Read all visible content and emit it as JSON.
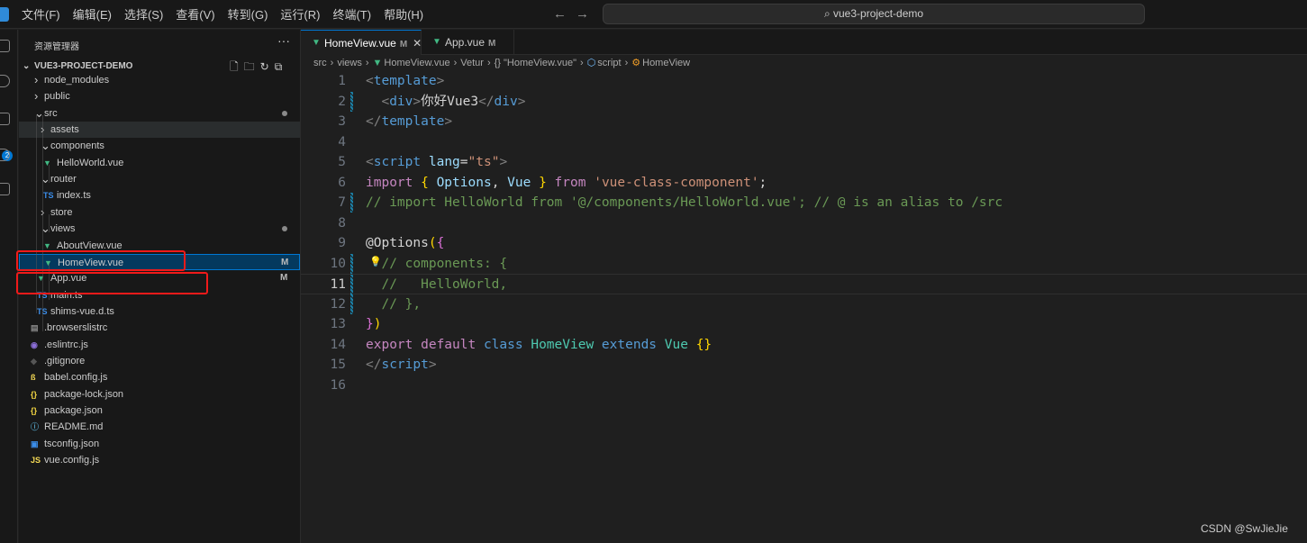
{
  "menu": [
    "文件(F)",
    "编辑(E)",
    "选择(S)",
    "查看(V)",
    "转到(G)",
    "运行(R)",
    "终端(T)",
    "帮助(H)"
  ],
  "search": {
    "label": "vue3-project-demo",
    "icon": "search-icon"
  },
  "activity": {
    "badge": "2"
  },
  "explorer": {
    "title": "资源管理器",
    "more": "···",
    "project": "VUE3-PROJECT-DEMO",
    "tree": [
      {
        "label": "node_modules",
        "kind": "folder",
        "depth": 1,
        "open": false
      },
      {
        "label": "public",
        "kind": "folder",
        "depth": 1,
        "open": false
      },
      {
        "label": "src",
        "kind": "folder",
        "depth": 1,
        "open": true,
        "dot": true
      },
      {
        "label": "assets",
        "kind": "folder",
        "depth": 2,
        "open": false,
        "hover": true
      },
      {
        "label": "components",
        "kind": "folder",
        "depth": 2,
        "open": true
      },
      {
        "label": "HelloWorld.vue",
        "kind": "vue",
        "depth": 3
      },
      {
        "label": "router",
        "kind": "folder",
        "depth": 2,
        "open": true
      },
      {
        "label": "index.ts",
        "kind": "ts",
        "depth": 3
      },
      {
        "label": "store",
        "kind": "folder",
        "depth": 2,
        "open": false
      },
      {
        "label": "views",
        "kind": "folder",
        "depth": 2,
        "open": true,
        "dot": true
      },
      {
        "label": "AboutView.vue",
        "kind": "vue",
        "depth": 3
      },
      {
        "label": "HomeView.vue",
        "kind": "vue",
        "depth": 3,
        "selected": true,
        "status": "M"
      },
      {
        "label": "App.vue",
        "kind": "vue",
        "depth": 2,
        "status": "M"
      },
      {
        "label": "main.ts",
        "kind": "ts",
        "depth": 2
      },
      {
        "label": "shims-vue.d.ts",
        "kind": "ts",
        "depth": 2
      },
      {
        "label": ".browserslistrc",
        "kind": "file",
        "depth": 1
      },
      {
        "label": ".eslintrc.js",
        "kind": "eslint",
        "depth": 1
      },
      {
        "label": ".gitignore",
        "kind": "git",
        "depth": 1
      },
      {
        "label": "babel.config.js",
        "kind": "babel",
        "depth": 1
      },
      {
        "label": "package-lock.json",
        "kind": "json",
        "depth": 1
      },
      {
        "label": "package.json",
        "kind": "json",
        "depth": 1
      },
      {
        "label": "README.md",
        "kind": "info",
        "depth": 1
      },
      {
        "label": "tsconfig.json",
        "kind": "tsconfig",
        "depth": 1
      },
      {
        "label": "vue.config.js",
        "kind": "js",
        "depth": 1
      }
    ]
  },
  "tabs": [
    {
      "label": "HomeView.vue",
      "status": "M",
      "active": true,
      "close": "✕"
    },
    {
      "label": "App.vue",
      "status": "M",
      "active": false
    }
  ],
  "breadcrumb": [
    "src",
    "views",
    "HomeView.vue",
    "Vetur",
    "{} \"HomeView.vue\"",
    "script",
    "HomeView"
  ],
  "editor": {
    "current_line": 11,
    "lines": [
      [
        [
          "<",
          "tag"
        ],
        [
          "template",
          "tn"
        ],
        [
          ">",
          "tag"
        ]
      ],
      [
        [
          "  ",
          "pl"
        ],
        [
          "<",
          "tag"
        ],
        [
          "div",
          "tn"
        ],
        [
          ">",
          "tag"
        ],
        [
          "你好Vue3",
          "pl"
        ],
        [
          "</",
          "tag"
        ],
        [
          "div",
          "tn"
        ],
        [
          ">",
          "tag"
        ]
      ],
      [
        [
          "</",
          "tag"
        ],
        [
          "template",
          "tn"
        ],
        [
          ">",
          "tag"
        ]
      ],
      [],
      [
        [
          "<",
          "tag"
        ],
        [
          "script",
          "tn"
        ],
        [
          " lang",
          "at"
        ],
        [
          "=",
          "pl"
        ],
        [
          "\"ts\"",
          "str"
        ],
        [
          ">",
          "tag"
        ]
      ],
      [
        [
          "import ",
          "kw"
        ],
        [
          "{ ",
          "b1"
        ],
        [
          "Options",
          "var"
        ],
        [
          ", ",
          "pl"
        ],
        [
          "Vue",
          "var"
        ],
        [
          " }",
          "b1"
        ],
        [
          " from ",
          "kw"
        ],
        [
          "'vue-class-component'",
          "str"
        ],
        [
          ";",
          "pl"
        ]
      ],
      [
        [
          "// import HelloWorld from '@/components/HelloWorld.vue'; // @ is an alias to /src",
          "cm"
        ]
      ],
      [],
      [
        [
          "@Options",
          "pl"
        ],
        [
          "(",
          "b1"
        ],
        [
          "{",
          "b2"
        ]
      ],
      [
        [
          "  // components: {",
          "cm"
        ]
      ],
      [
        [
          "  //   HelloWorld,",
          "cm"
        ]
      ],
      [
        [
          "  // },",
          "cm"
        ]
      ],
      [
        [
          "}",
          "b2"
        ],
        [
          ")",
          "b1"
        ]
      ],
      [
        [
          "export ",
          "kw"
        ],
        [
          "default ",
          "kw"
        ],
        [
          "class ",
          "st2"
        ],
        [
          "HomeView ",
          "cl"
        ],
        [
          "extends ",
          "st2"
        ],
        [
          "Vue ",
          "cl"
        ],
        [
          "{}",
          "b1"
        ]
      ],
      [
        [
          "</",
          "tag"
        ],
        [
          "script",
          "tn"
        ],
        [
          ">",
          "tag"
        ]
      ],
      []
    ],
    "modified_lines": [
      2,
      7,
      10,
      11,
      12
    ]
  },
  "watermark": "CSDN @SwJieJie"
}
